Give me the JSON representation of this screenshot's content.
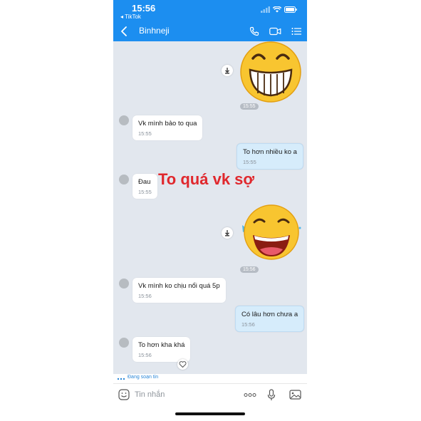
{
  "status_bar": {
    "time": "15:56",
    "back_app": "◂ TikTok"
  },
  "header": {
    "contact_name": "Binhneji"
  },
  "messages": [
    {
      "side": "in",
      "text": "Vk mình bảo to qua",
      "time": "15:55"
    },
    {
      "side": "out",
      "text": "To hơn nhiều ko a",
      "time": "15:55"
    },
    {
      "side": "in",
      "text": "Đau",
      "time": "15:55"
    },
    {
      "side": "in",
      "text": "Vk mình ko chịu nổi quá 5p",
      "time": "15:56"
    },
    {
      "side": "out",
      "text": "Có lâu hơn chưa a",
      "time": "15:56"
    },
    {
      "side": "in",
      "text": "To hơn kha khá",
      "time": "15:56"
    }
  ],
  "stickers": [
    {
      "name": "grinning-emoji-sticker",
      "time": "15:55"
    },
    {
      "name": "laughing-emoji-sticker",
      "time": "15:56"
    }
  ],
  "overlay_caption": "To quá vk sợ",
  "typing_indicator": "Đang soạn tin",
  "composer": {
    "placeholder": "Tin nhắn"
  },
  "colors": {
    "header_blue": "#1c8ef0",
    "chat_bg": "#e2e7ee",
    "outgoing_bubble": "#d6ecfb",
    "caption_red": "#e0282d"
  }
}
